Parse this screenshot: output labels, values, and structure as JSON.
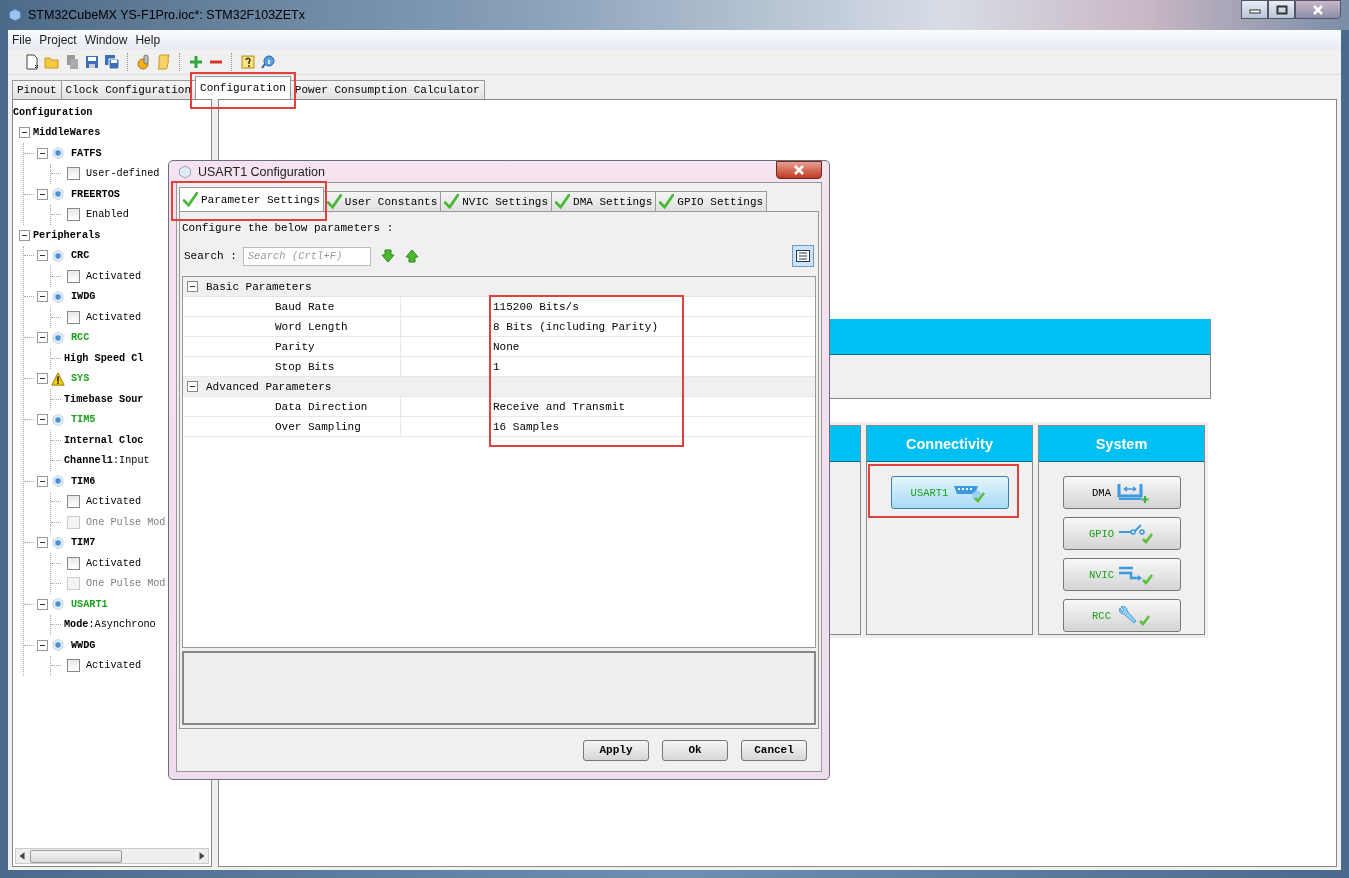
{
  "window": {
    "title": "STM32CubeMX YS-F1Pro.ioc*: STM32F103ZETx"
  },
  "menu": [
    "File",
    "Project",
    "Window",
    "Help"
  ],
  "toolbar": [
    {
      "kind": "new"
    },
    {
      "kind": "open"
    },
    {
      "kind": "copy"
    },
    {
      "kind": "save"
    },
    {
      "kind": "saveall"
    },
    {
      "kind": "sep"
    },
    {
      "kind": "generate"
    },
    {
      "kind": "script"
    },
    {
      "kind": "sep"
    },
    {
      "kind": "plus"
    },
    {
      "kind": "minus"
    },
    {
      "kind": "sep"
    },
    {
      "kind": "help"
    },
    {
      "kind": "info"
    }
  ],
  "tabs": [
    {
      "label": "Pinout",
      "selected": false
    },
    {
      "label": "Clock Configuration",
      "selected": false
    },
    {
      "label": "Configuration",
      "selected": true
    },
    {
      "label": "Power Consumption Calculator",
      "selected": false
    }
  ],
  "tree": {
    "label": "Configuration",
    "children": [
      {
        "kind": "group",
        "label": "MiddleWares",
        "expanded": true,
        "children": [
          {
            "kind": "component",
            "label": "FATFS",
            "configured": false,
            "warning": false,
            "expanded": true,
            "children": [
              {
                "kind": "checkbox",
                "label": "User-defined",
                "checked": false,
                "disabled": false
              }
            ]
          },
          {
            "kind": "component",
            "label": "FREERTOS",
            "configured": false,
            "warning": false,
            "expanded": true,
            "children": [
              {
                "kind": "checkbox",
                "label": "Enabled",
                "checked": false,
                "disabled": false
              }
            ]
          }
        ]
      },
      {
        "kind": "group",
        "label": "Peripherals",
        "expanded": true,
        "children": [
          {
            "kind": "component",
            "label": "CRC",
            "configured": false,
            "warning": false,
            "expanded": true,
            "children": [
              {
                "kind": "checkbox",
                "label": "Activated",
                "checked": false,
                "disabled": false
              }
            ]
          },
          {
            "kind": "component",
            "label": "IWDG",
            "configured": false,
            "warning": false,
            "expanded": true,
            "children": [
              {
                "kind": "checkbox",
                "label": "Activated",
                "checked": false,
                "disabled": false
              }
            ]
          },
          {
            "kind": "component",
            "label": "RCC",
            "configured": true,
            "warning": false,
            "expanded": true,
            "children": [
              {
                "kind": "text",
                "label": "High Speed Cl"
              }
            ]
          },
          {
            "kind": "component",
            "label": "SYS",
            "configured": true,
            "warning": true,
            "expanded": true,
            "children": [
              {
                "kind": "text",
                "label": "Timebase Sour"
              }
            ]
          },
          {
            "kind": "component",
            "label": "TIM5",
            "configured": true,
            "warning": false,
            "expanded": true,
            "children": [
              {
                "kind": "text",
                "label": "Internal Cloc"
              },
              {
                "kind": "text",
                "label": "Channel1",
                "value": ":Input"
              }
            ]
          },
          {
            "kind": "component",
            "label": "TIM6",
            "configured": false,
            "warning": false,
            "expanded": true,
            "children": [
              {
                "kind": "checkbox",
                "label": "Activated",
                "checked": false,
                "disabled": false
              },
              {
                "kind": "checkbox",
                "label": "One Pulse Mod",
                "checked": false,
                "disabled": true
              }
            ]
          },
          {
            "kind": "component",
            "label": "TIM7",
            "configured": false,
            "warning": false,
            "expanded": true,
            "children": [
              {
                "kind": "checkbox",
                "label": "Activated",
                "checked": false,
                "disabled": false
              },
              {
                "kind": "checkbox",
                "label": "One Pulse Mod",
                "checked": false,
                "disabled": true
              }
            ]
          },
          {
            "kind": "component",
            "label": "USART1",
            "configured": true,
            "warning": false,
            "expanded": true,
            "children": [
              {
                "kind": "text",
                "label": "Mode",
                "value": ":Asynchrono"
              }
            ]
          },
          {
            "kind": "component",
            "label": "WWDG",
            "configured": false,
            "warning": false,
            "expanded": true,
            "children": [
              {
                "kind": "checkbox",
                "label": "Activated",
                "checked": false,
                "disabled": false
              }
            ]
          }
        ]
      }
    ]
  },
  "categories": [
    {
      "kind": "panel"
    },
    {
      "kind": "category",
      "title": "Connectivity",
      "buttons": [
        {
          "label": "USART1",
          "kind": "serial",
          "configured": true,
          "selected": true
        }
      ]
    },
    {
      "kind": "category",
      "title": "System",
      "buttons": [
        {
          "label": "DMA",
          "kind": "dma",
          "configured": false,
          "selected": false
        },
        {
          "label": "GPIO",
          "kind": "gpio",
          "configured": true,
          "selected": false
        },
        {
          "label": "NVIC",
          "kind": "nvic",
          "configured": true,
          "selected": false
        },
        {
          "label": "RCC",
          "kind": "rcc",
          "configured": true,
          "selected": false
        }
      ]
    }
  ],
  "dialog": {
    "title": "USART1 Configuration",
    "tabs": [
      {
        "label": "Parameter Settings",
        "selected": true
      },
      {
        "label": "User Constants",
        "selected": false
      },
      {
        "label": "NVIC Settings",
        "selected": false
      },
      {
        "label": "DMA Settings",
        "selected": false
      },
      {
        "label": "GPIO Settings",
        "selected": false
      }
    ],
    "intro": "Configure the below parameters :",
    "search_label": "Search :",
    "search": {
      "placeholder": "Search (Crtl+F)"
    },
    "groups": [
      {
        "title": "Basic Parameters",
        "expanded": true,
        "rows": [
          {
            "name": "Baud Rate",
            "value": "115200 Bits/s"
          },
          {
            "name": "Word Length",
            "value": "8 Bits (including Parity)"
          },
          {
            "name": "Parity",
            "value": "None"
          },
          {
            "name": "Stop Bits",
            "value": "1"
          }
        ]
      },
      {
        "title": "Advanced Parameters",
        "expanded": true,
        "rows": [
          {
            "name": "Data Direction",
            "value": "Receive and Transmit"
          },
          {
            "name": "Over Sampling",
            "value": "16 Samples"
          }
        ]
      }
    ],
    "buttons": [
      "Apply",
      "Ok",
      "Cancel"
    ]
  }
}
